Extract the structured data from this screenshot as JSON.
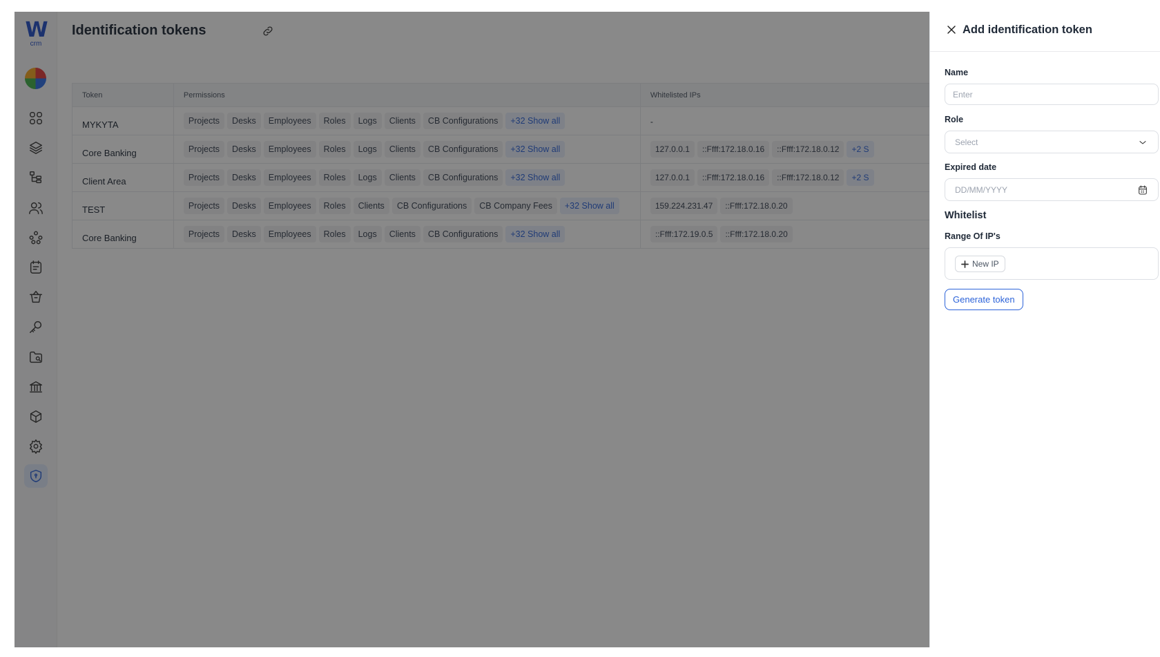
{
  "logo": {
    "mark": "W",
    "sub": "crm"
  },
  "sidebar": {
    "icons": [
      "dashboard-grid-icon",
      "layers-icon",
      "hierarchy-icon",
      "users-icon",
      "organization-icon",
      "notes-icon",
      "basket-icon",
      "key-icon",
      "folder-icon",
      "bank-icon",
      "cube-icon",
      "settings-icon",
      "shield-icon"
    ],
    "active": "shield-icon"
  },
  "page": {
    "title": "Identification tokens"
  },
  "table": {
    "headers": {
      "token": "Token",
      "permissions": "Permissions",
      "whitelisted": "Whitelisted IPs"
    },
    "rows": [
      {
        "name": "MYKYTA",
        "permissions": [
          "Projects",
          "Desks",
          "Employees",
          "Roles",
          "Logs",
          "Clients",
          "CB Configurations"
        ],
        "more": "+32 Show all",
        "ips": [
          "-"
        ],
        "ip_more": ""
      },
      {
        "name": "Core Banking",
        "permissions": [
          "Projects",
          "Desks",
          "Employees",
          "Roles",
          "Logs",
          "Clients",
          "CB Configurations"
        ],
        "more": "+32 Show all",
        "ips": [
          "127.0.0.1",
          "::Ffff:172.18.0.16",
          "::Ffff:172.18.0.12"
        ],
        "ip_more": "+2 S"
      },
      {
        "name": "Client Area",
        "permissions": [
          "Projects",
          "Desks",
          "Employees",
          "Roles",
          "Logs",
          "Clients",
          "CB Configurations"
        ],
        "more": "+32 Show all",
        "ips": [
          "127.0.0.1",
          "::Ffff:172.18.0.16",
          "::Ffff:172.18.0.12"
        ],
        "ip_more": "+2 S"
      },
      {
        "name": "TEST",
        "permissions": [
          "Projects",
          "Desks",
          "Employees",
          "Roles",
          "Clients",
          "CB Configurations",
          "CB Company Fees"
        ],
        "more": "+32 Show all",
        "ips": [
          "159.224.231.47",
          "::Ffff:172.18.0.20"
        ],
        "ip_more": ""
      },
      {
        "name": "Core Banking",
        "permissions": [
          "Projects",
          "Desks",
          "Employees",
          "Roles",
          "Logs",
          "Clients",
          "CB Configurations"
        ],
        "more": "+32 Show all",
        "ips": [
          "::Ffff:172.19.0.5",
          "::Ffff:172.18.0.20"
        ],
        "ip_more": ""
      }
    ]
  },
  "drawer": {
    "title": "Add identification token",
    "name_label": "Name",
    "name_placeholder": "Enter",
    "role_label": "Role",
    "role_placeholder": "Select",
    "date_label": "Expired date",
    "date_placeholder": "DD/MM/YYYY",
    "whitelist_title": "Whitelist",
    "range_label": "Range Of IP's",
    "new_ip_label": "New IP",
    "generate_label": "Generate token"
  },
  "colors": {
    "accent": "#2c63d9",
    "overlay": "rgba(20,20,20,0.5)"
  }
}
